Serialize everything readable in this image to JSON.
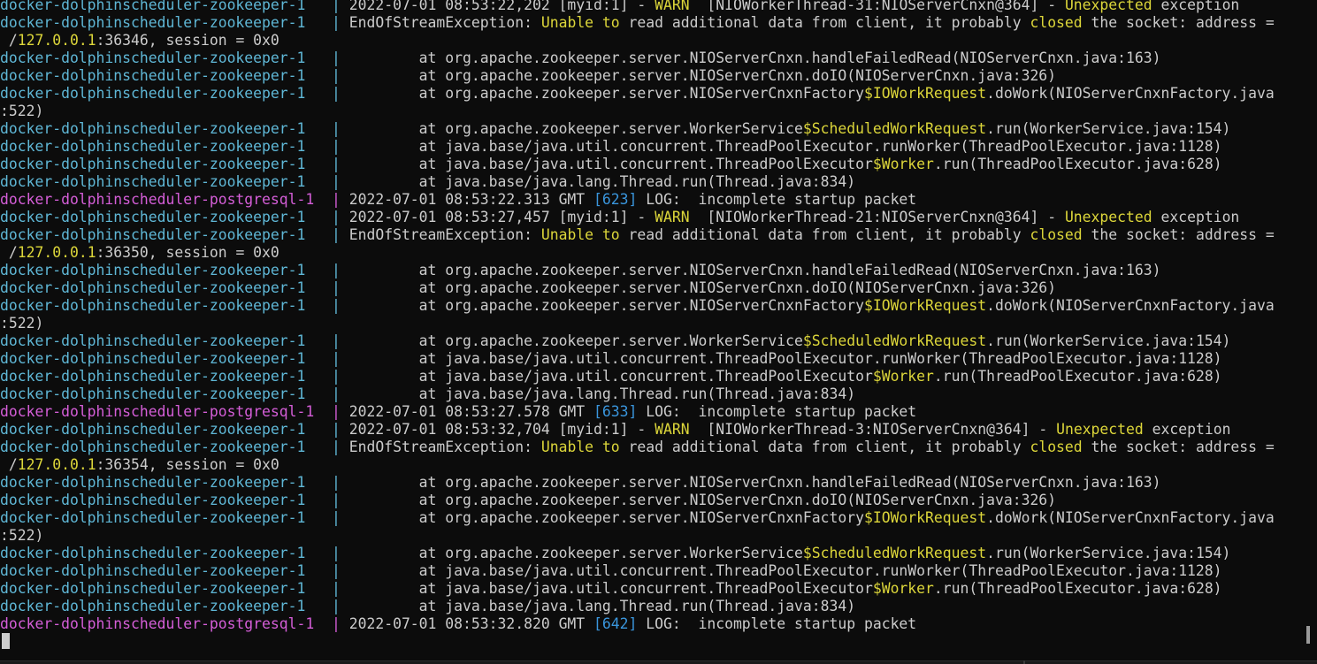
{
  "terminal": {
    "colors": {
      "background": "#0c0c0c",
      "foreground": "#cccccc",
      "zookeeper": "#5fb7d6",
      "postgresql": "#d55ed8",
      "highlight_yellow": "#dcd63a",
      "highlight_blue": "#3a96dd"
    },
    "lines": [
      [
        [
          "zk",
          "docker-dolphinscheduler-zookeeper-1   | "
        ],
        [
          "t",
          "2022-07-01 08:53:22,202 [myid:1] - "
        ],
        [
          "y",
          "WARN"
        ],
        [
          "t",
          "  [NIOWorkerThread-31:NIOServerCnxn@364] - "
        ],
        [
          "y",
          "Unexpected"
        ],
        [
          "t",
          " exception"
        ]
      ],
      [
        [
          "zk",
          "docker-dolphinscheduler-zookeeper-1   | "
        ],
        [
          "t",
          "EndOfStreamException: "
        ],
        [
          "y",
          "Unable to"
        ],
        [
          "t",
          " read additional data from client, it probably "
        ],
        [
          "y",
          "closed"
        ],
        [
          "t",
          " the socket: address ="
        ]
      ],
      [
        [
          "t",
          " /"
        ],
        [
          "y",
          "127.0.0.1"
        ],
        [
          "t",
          ":36346, session = 0x0"
        ]
      ],
      [
        [
          "zk",
          "docker-dolphinscheduler-zookeeper-1   | "
        ],
        [
          "t",
          "        at org.apache.zookeeper.server.NIOServerCnxn.handleFailedRead(NIOServerCnxn.java:163)"
        ]
      ],
      [
        [
          "zk",
          "docker-dolphinscheduler-zookeeper-1   | "
        ],
        [
          "t",
          "        at org.apache.zookeeper.server.NIOServerCnxn.doIO(NIOServerCnxn.java:326)"
        ]
      ],
      [
        [
          "zk",
          "docker-dolphinscheduler-zookeeper-1   | "
        ],
        [
          "t",
          "        at org.apache.zookeeper.server.NIOServerCnxnFactory"
        ],
        [
          "y",
          "$IOWorkRequest"
        ],
        [
          "t",
          ".doWork(NIOServerCnxnFactory.java"
        ]
      ],
      [
        [
          "t",
          ":522)"
        ]
      ],
      [
        [
          "zk",
          "docker-dolphinscheduler-zookeeper-1   | "
        ],
        [
          "t",
          "        at org.apache.zookeeper.server.WorkerService"
        ],
        [
          "y",
          "$ScheduledWorkRequest"
        ],
        [
          "t",
          ".run(WorkerService.java:154)"
        ]
      ],
      [
        [
          "zk",
          "docker-dolphinscheduler-zookeeper-1   | "
        ],
        [
          "t",
          "        at java.base/java.util.concurrent.ThreadPoolExecutor.runWorker(ThreadPoolExecutor.java:1128)"
        ]
      ],
      [
        [
          "zk",
          "docker-dolphinscheduler-zookeeper-1   | "
        ],
        [
          "t",
          "        at java.base/java.util.concurrent.ThreadPoolExecutor"
        ],
        [
          "y",
          "$Worker"
        ],
        [
          "t",
          ".run(ThreadPoolExecutor.java:628)"
        ]
      ],
      [
        [
          "zk",
          "docker-dolphinscheduler-zookeeper-1   | "
        ],
        [
          "t",
          "        at java.base/java.lang.Thread.run(Thread.java:834)"
        ]
      ],
      [
        [
          "pg",
          "docker-dolphinscheduler-postgresql-1  | "
        ],
        [
          "t",
          "2022-07-01 08:53:22.313 GMT "
        ],
        [
          "b",
          "[623]"
        ],
        [
          "t",
          " LOG:  incomplete startup packet"
        ]
      ],
      [
        [
          "zk",
          "docker-dolphinscheduler-zookeeper-1   | "
        ],
        [
          "t",
          "2022-07-01 08:53:27,457 [myid:1] - "
        ],
        [
          "y",
          "WARN"
        ],
        [
          "t",
          "  [NIOWorkerThread-21:NIOServerCnxn@364] - "
        ],
        [
          "y",
          "Unexpected"
        ],
        [
          "t",
          " exception"
        ]
      ],
      [
        [
          "zk",
          "docker-dolphinscheduler-zookeeper-1   | "
        ],
        [
          "t",
          "EndOfStreamException: "
        ],
        [
          "y",
          "Unable to"
        ],
        [
          "t",
          " read additional data from client, it probably "
        ],
        [
          "y",
          "closed"
        ],
        [
          "t",
          " the socket: address ="
        ]
      ],
      [
        [
          "t",
          " /"
        ],
        [
          "y",
          "127.0.0.1"
        ],
        [
          "t",
          ":36350, session = 0x0"
        ]
      ],
      [
        [
          "zk",
          "docker-dolphinscheduler-zookeeper-1   | "
        ],
        [
          "t",
          "        at org.apache.zookeeper.server.NIOServerCnxn.handleFailedRead(NIOServerCnxn.java:163)"
        ]
      ],
      [
        [
          "zk",
          "docker-dolphinscheduler-zookeeper-1   | "
        ],
        [
          "t",
          "        at org.apache.zookeeper.server.NIOServerCnxn.doIO(NIOServerCnxn.java:326)"
        ]
      ],
      [
        [
          "zk",
          "docker-dolphinscheduler-zookeeper-1   | "
        ],
        [
          "t",
          "        at org.apache.zookeeper.server.NIOServerCnxnFactory"
        ],
        [
          "y",
          "$IOWorkRequest"
        ],
        [
          "t",
          ".doWork(NIOServerCnxnFactory.java"
        ]
      ],
      [
        [
          "t",
          ":522)"
        ]
      ],
      [
        [
          "zk",
          "docker-dolphinscheduler-zookeeper-1   | "
        ],
        [
          "t",
          "        at org.apache.zookeeper.server.WorkerService"
        ],
        [
          "y",
          "$ScheduledWorkRequest"
        ],
        [
          "t",
          ".run(WorkerService.java:154)"
        ]
      ],
      [
        [
          "zk",
          "docker-dolphinscheduler-zookeeper-1   | "
        ],
        [
          "t",
          "        at java.base/java.util.concurrent.ThreadPoolExecutor.runWorker(ThreadPoolExecutor.java:1128)"
        ]
      ],
      [
        [
          "zk",
          "docker-dolphinscheduler-zookeeper-1   | "
        ],
        [
          "t",
          "        at java.base/java.util.concurrent.ThreadPoolExecutor"
        ],
        [
          "y",
          "$Worker"
        ],
        [
          "t",
          ".run(ThreadPoolExecutor.java:628)"
        ]
      ],
      [
        [
          "zk",
          "docker-dolphinscheduler-zookeeper-1   | "
        ],
        [
          "t",
          "        at java.base/java.lang.Thread.run(Thread.java:834)"
        ]
      ],
      [
        [
          "pg",
          "docker-dolphinscheduler-postgresql-1  | "
        ],
        [
          "t",
          "2022-07-01 08:53:27.578 GMT "
        ],
        [
          "b",
          "[633]"
        ],
        [
          "t",
          " LOG:  incomplete startup packet"
        ]
      ],
      [
        [
          "zk",
          "docker-dolphinscheduler-zookeeper-1   | "
        ],
        [
          "t",
          "2022-07-01 08:53:32,704 [myid:1] - "
        ],
        [
          "y",
          "WARN"
        ],
        [
          "t",
          "  [NIOWorkerThread-3:NIOServerCnxn@364] - "
        ],
        [
          "y",
          "Unexpected"
        ],
        [
          "t",
          " exception"
        ]
      ],
      [
        [
          "zk",
          "docker-dolphinscheduler-zookeeper-1   | "
        ],
        [
          "t",
          "EndOfStreamException: "
        ],
        [
          "y",
          "Unable to"
        ],
        [
          "t",
          " read additional data from client, it probably "
        ],
        [
          "y",
          "closed"
        ],
        [
          "t",
          " the socket: address ="
        ]
      ],
      [
        [
          "t",
          " /"
        ],
        [
          "y",
          "127.0.0.1"
        ],
        [
          "t",
          ":36354, session = 0x0"
        ]
      ],
      [
        [
          "zk",
          "docker-dolphinscheduler-zookeeper-1   | "
        ],
        [
          "t",
          "        at org.apache.zookeeper.server.NIOServerCnxn.handleFailedRead(NIOServerCnxn.java:163)"
        ]
      ],
      [
        [
          "zk",
          "docker-dolphinscheduler-zookeeper-1   | "
        ],
        [
          "t",
          "        at org.apache.zookeeper.server.NIOServerCnxn.doIO(NIOServerCnxn.java:326)"
        ]
      ],
      [
        [
          "zk",
          "docker-dolphinscheduler-zookeeper-1   | "
        ],
        [
          "t",
          "        at org.apache.zookeeper.server.NIOServerCnxnFactory"
        ],
        [
          "y",
          "$IOWorkRequest"
        ],
        [
          "t",
          ".doWork(NIOServerCnxnFactory.java"
        ]
      ],
      [
        [
          "t",
          ":522)"
        ]
      ],
      [
        [
          "zk",
          "docker-dolphinscheduler-zookeeper-1   | "
        ],
        [
          "t",
          "        at org.apache.zookeeper.server.WorkerService"
        ],
        [
          "y",
          "$ScheduledWorkRequest"
        ],
        [
          "t",
          ".run(WorkerService.java:154)"
        ]
      ],
      [
        [
          "zk",
          "docker-dolphinscheduler-zookeeper-1   | "
        ],
        [
          "t",
          "        at java.base/java.util.concurrent.ThreadPoolExecutor.runWorker(ThreadPoolExecutor.java:1128)"
        ]
      ],
      [
        [
          "zk",
          "docker-dolphinscheduler-zookeeper-1   | "
        ],
        [
          "t",
          "        at java.base/java.util.concurrent.ThreadPoolExecutor"
        ],
        [
          "y",
          "$Worker"
        ],
        [
          "t",
          ".run(ThreadPoolExecutor.java:628)"
        ]
      ],
      [
        [
          "zk",
          "docker-dolphinscheduler-zookeeper-1   | "
        ],
        [
          "t",
          "        at java.base/java.lang.Thread.run(Thread.java:834)"
        ]
      ],
      [
        [
          "pg",
          "docker-dolphinscheduler-postgresql-1  | "
        ],
        [
          "t",
          "2022-07-01 08:53:32.820 GMT "
        ],
        [
          "b",
          "[642]"
        ],
        [
          "t",
          " LOG:  incomplete startup packet"
        ]
      ]
    ]
  }
}
